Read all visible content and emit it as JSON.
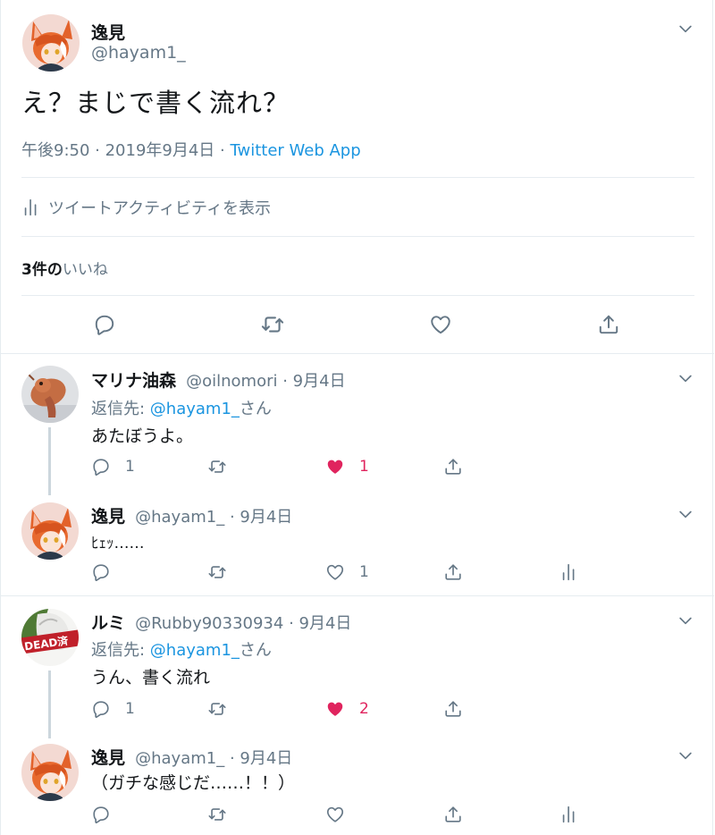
{
  "main_tweet": {
    "author_name": "逸見",
    "handle": "@hayam1_",
    "text": "え？まじで書く流れ？",
    "time": "午後9:50 · 2019年9月4日 · ",
    "source": "Twitter Web App",
    "activity_label": "ツイートアクティビティを表示",
    "likes_count": "3件の",
    "likes_label": "いいね"
  },
  "replies": [
    {
      "name": "マリナ油森",
      "handle": "@oilnomori",
      "date": " · 9月4日",
      "reply_to_prefix": "返信先: ",
      "reply_to_handle": "@hayam1_",
      "reply_to_suffix": "さん",
      "text": "あたぼうよ。",
      "reply_count": "1",
      "like_count": "1",
      "liked": true
    },
    {
      "name": "逸見",
      "handle": "@hayam1_",
      "date": " · 9月4日",
      "text": "ﾋｪｯ……",
      "reply_count": "",
      "like_count": "1",
      "liked": false
    },
    {
      "name": "ルミ",
      "handle": "@Rubby90330934",
      "date": " · 9月4日",
      "reply_to_prefix": "返信先: ",
      "reply_to_handle": "@hayam1_",
      "reply_to_suffix": "さん",
      "text": "うん、書く流れ",
      "reply_count": "1",
      "like_count": "2",
      "liked": true,
      "avatar_badge": "DEAD済"
    },
    {
      "name": "逸見",
      "handle": "@hayam1_",
      "date": " · 9月4日",
      "text": "（ガチな感じだ……！！）",
      "reply_count": "",
      "like_count": "",
      "liked": false
    }
  ],
  "colors": {
    "accent": "#1b95e0",
    "like": "#e0245e",
    "icon": "#657786",
    "divider": "#e6ecf0"
  },
  "icons": [
    "chevron-down-icon",
    "reply-icon",
    "retweet-icon",
    "like-icon",
    "share-icon",
    "analytics-icon"
  ]
}
